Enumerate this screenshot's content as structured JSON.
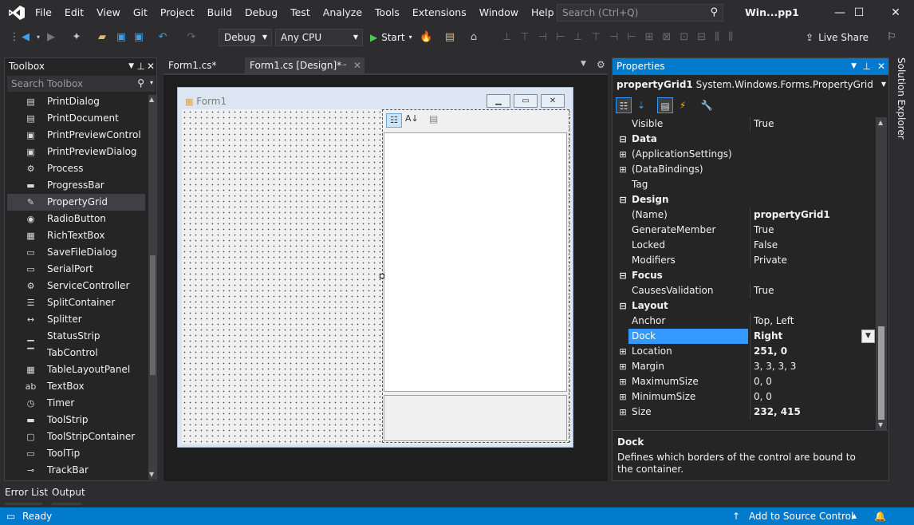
{
  "menu": {
    "items": [
      "File",
      "Edit",
      "View",
      "Git",
      "Project",
      "Build",
      "Debug",
      "Test",
      "Analyze",
      "Tools",
      "Extensions",
      "Window",
      "Help"
    ],
    "search_placeholder": "Search (Ctrl+Q)",
    "solution_short": "Win...pp1",
    "minimize": "—",
    "maximize": "☐",
    "close": "✕"
  },
  "toolbar": {
    "config": "Debug",
    "platform": "Any CPU",
    "start": "Start",
    "live_share": "Live Share"
  },
  "toolbox": {
    "title": "Toolbox",
    "search_placeholder": "Search Toolbox",
    "items": [
      {
        "label": "PrintDialog",
        "icon": "print-dialog-icon",
        "glyph": "▤"
      },
      {
        "label": "PrintDocument",
        "icon": "print-document-icon",
        "glyph": "▤"
      },
      {
        "label": "PrintPreviewControl",
        "icon": "print-preview-control-icon",
        "glyph": "▣"
      },
      {
        "label": "PrintPreviewDialog",
        "icon": "print-preview-dialog-icon",
        "glyph": "▣"
      },
      {
        "label": "Process",
        "icon": "process-icon",
        "glyph": "⚙"
      },
      {
        "label": "ProgressBar",
        "icon": "progressbar-icon",
        "glyph": "▬"
      },
      {
        "label": "PropertyGrid",
        "icon": "propertygrid-icon",
        "glyph": "✎"
      },
      {
        "label": "RadioButton",
        "icon": "radiobutton-icon",
        "glyph": "◉"
      },
      {
        "label": "RichTextBox",
        "icon": "richtextbox-icon",
        "glyph": "▦"
      },
      {
        "label": "SaveFileDialog",
        "icon": "savefiledialog-icon",
        "glyph": "▭"
      },
      {
        "label": "SerialPort",
        "icon": "serialport-icon",
        "glyph": "▭"
      },
      {
        "label": "ServiceController",
        "icon": "servicecontroller-icon",
        "glyph": "⚙"
      },
      {
        "label": "SplitContainer",
        "icon": "splitcontainer-icon",
        "glyph": "☰"
      },
      {
        "label": "Splitter",
        "icon": "splitter-icon",
        "glyph": "↔"
      },
      {
        "label": "StatusStrip",
        "icon": "statusstrip-icon",
        "glyph": "▁"
      },
      {
        "label": "TabControl",
        "icon": "tabcontrol-icon",
        "glyph": "▔"
      },
      {
        "label": "TableLayoutPanel",
        "icon": "tablelayoutpanel-icon",
        "glyph": "▦"
      },
      {
        "label": "TextBox",
        "icon": "textbox-icon",
        "glyph": "ab"
      },
      {
        "label": "Timer",
        "icon": "timer-icon",
        "glyph": "◷"
      },
      {
        "label": "ToolStrip",
        "icon": "toolstrip-icon",
        "glyph": "▬"
      },
      {
        "label": "ToolStripContainer",
        "icon": "toolstripcontainer-icon",
        "glyph": "▢"
      },
      {
        "label": "ToolTip",
        "icon": "tooltip-icon",
        "glyph": "▭"
      },
      {
        "label": "TrackBar",
        "icon": "trackbar-icon",
        "glyph": "⊸"
      }
    ],
    "selected_index": 6
  },
  "editor": {
    "tabs": [
      {
        "label": "Form1.cs*",
        "active": false
      },
      {
        "label": "Form1.cs [Design]*",
        "active": true
      }
    ],
    "form_title": "Form1"
  },
  "properties": {
    "title": "Properties",
    "object_name": "propertyGrid1",
    "object_type": "System.Windows.Forms.PropertyGrid",
    "rows": [
      {
        "kind": "prop",
        "name": "Visible",
        "value": "True"
      },
      {
        "kind": "cat",
        "name": "Data",
        "expander": "⊟"
      },
      {
        "kind": "prop",
        "name": "(ApplicationSettings)",
        "value": "",
        "expander": "⊞"
      },
      {
        "kind": "prop",
        "name": "(DataBindings)",
        "value": "",
        "expander": "⊞"
      },
      {
        "kind": "prop",
        "name": "Tag",
        "value": ""
      },
      {
        "kind": "cat",
        "name": "Design",
        "expander": "⊟"
      },
      {
        "kind": "prop",
        "name": "(Name)",
        "value": "propertyGrid1",
        "bold": true
      },
      {
        "kind": "prop",
        "name": "GenerateMember",
        "value": "True"
      },
      {
        "kind": "prop",
        "name": "Locked",
        "value": "False"
      },
      {
        "kind": "prop",
        "name": "Modifiers",
        "value": "Private"
      },
      {
        "kind": "cat",
        "name": "Focus",
        "expander": "⊟"
      },
      {
        "kind": "prop",
        "name": "CausesValidation",
        "value": "True"
      },
      {
        "kind": "cat",
        "name": "Layout",
        "expander": "⊟"
      },
      {
        "kind": "prop",
        "name": "Anchor",
        "value": "Top, Left"
      },
      {
        "kind": "prop",
        "name": "Dock",
        "value": "Right",
        "bold": true,
        "selected": true
      },
      {
        "kind": "prop",
        "name": "Location",
        "value": "251, 0",
        "bold": true,
        "expander": "⊞"
      },
      {
        "kind": "prop",
        "name": "Margin",
        "value": "3, 3, 3, 3",
        "expander": "⊞"
      },
      {
        "kind": "prop",
        "name": "MaximumSize",
        "value": "0, 0",
        "expander": "⊞"
      },
      {
        "kind": "prop",
        "name": "MinimumSize",
        "value": "0, 0",
        "expander": "⊞"
      },
      {
        "kind": "prop",
        "name": "Size",
        "value": "232, 415",
        "bold": true,
        "expander": "⊞"
      }
    ],
    "description_title": "Dock",
    "description_text": "Defines which borders of the control are bound to the container."
  },
  "side": {
    "solution_explorer": "Solution Explorer"
  },
  "bottom_tabs": [
    "Error List",
    "Output"
  ],
  "status": {
    "ready": "Ready",
    "source_control": "Add to Source Control"
  },
  "colors": {
    "accent": "#007acc",
    "selection": "#3399ff"
  }
}
